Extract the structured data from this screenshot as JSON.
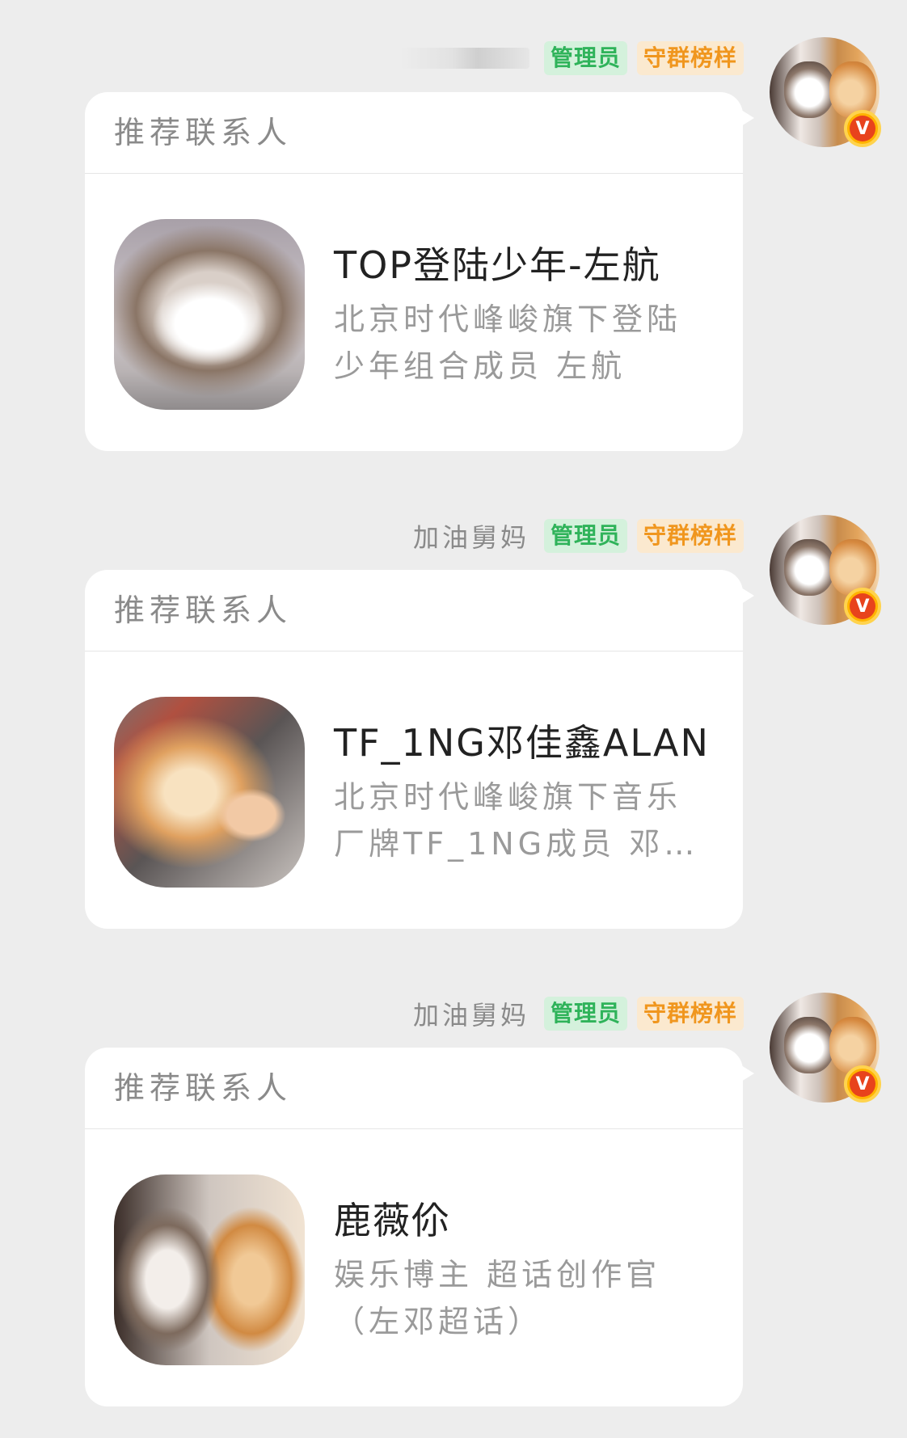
{
  "messages": [
    {
      "sender": "",
      "badges": {
        "admin": "管理员",
        "model": "守群榜样"
      },
      "card_title": "推荐联系人",
      "contact_name": "TOP登陆少年-左航",
      "contact_desc": "北京时代峰峻旗下登陆少年组合成员 左航"
    },
    {
      "sender": "加油舅妈",
      "badges": {
        "admin": "管理员",
        "model": "守群榜样"
      },
      "card_title": "推荐联系人",
      "contact_name": "TF_1NG邓佳鑫ALAN",
      "contact_desc": "北京时代峰峻旗下音乐厂牌TF_1NG成员 邓…"
    },
    {
      "sender": "加油舅妈",
      "badges": {
        "admin": "管理员",
        "model": "守群榜样"
      },
      "card_title": "推荐联系人",
      "contact_name": "鹿薇伱",
      "contact_desc": "娱乐博主 超话创作官（左邓超话）"
    }
  ],
  "verified_mark": "V",
  "colors": {
    "background": "#ededed",
    "admin_badge": "#2fb35a",
    "model_badge": "#f0961e",
    "card": "#ffffff"
  }
}
